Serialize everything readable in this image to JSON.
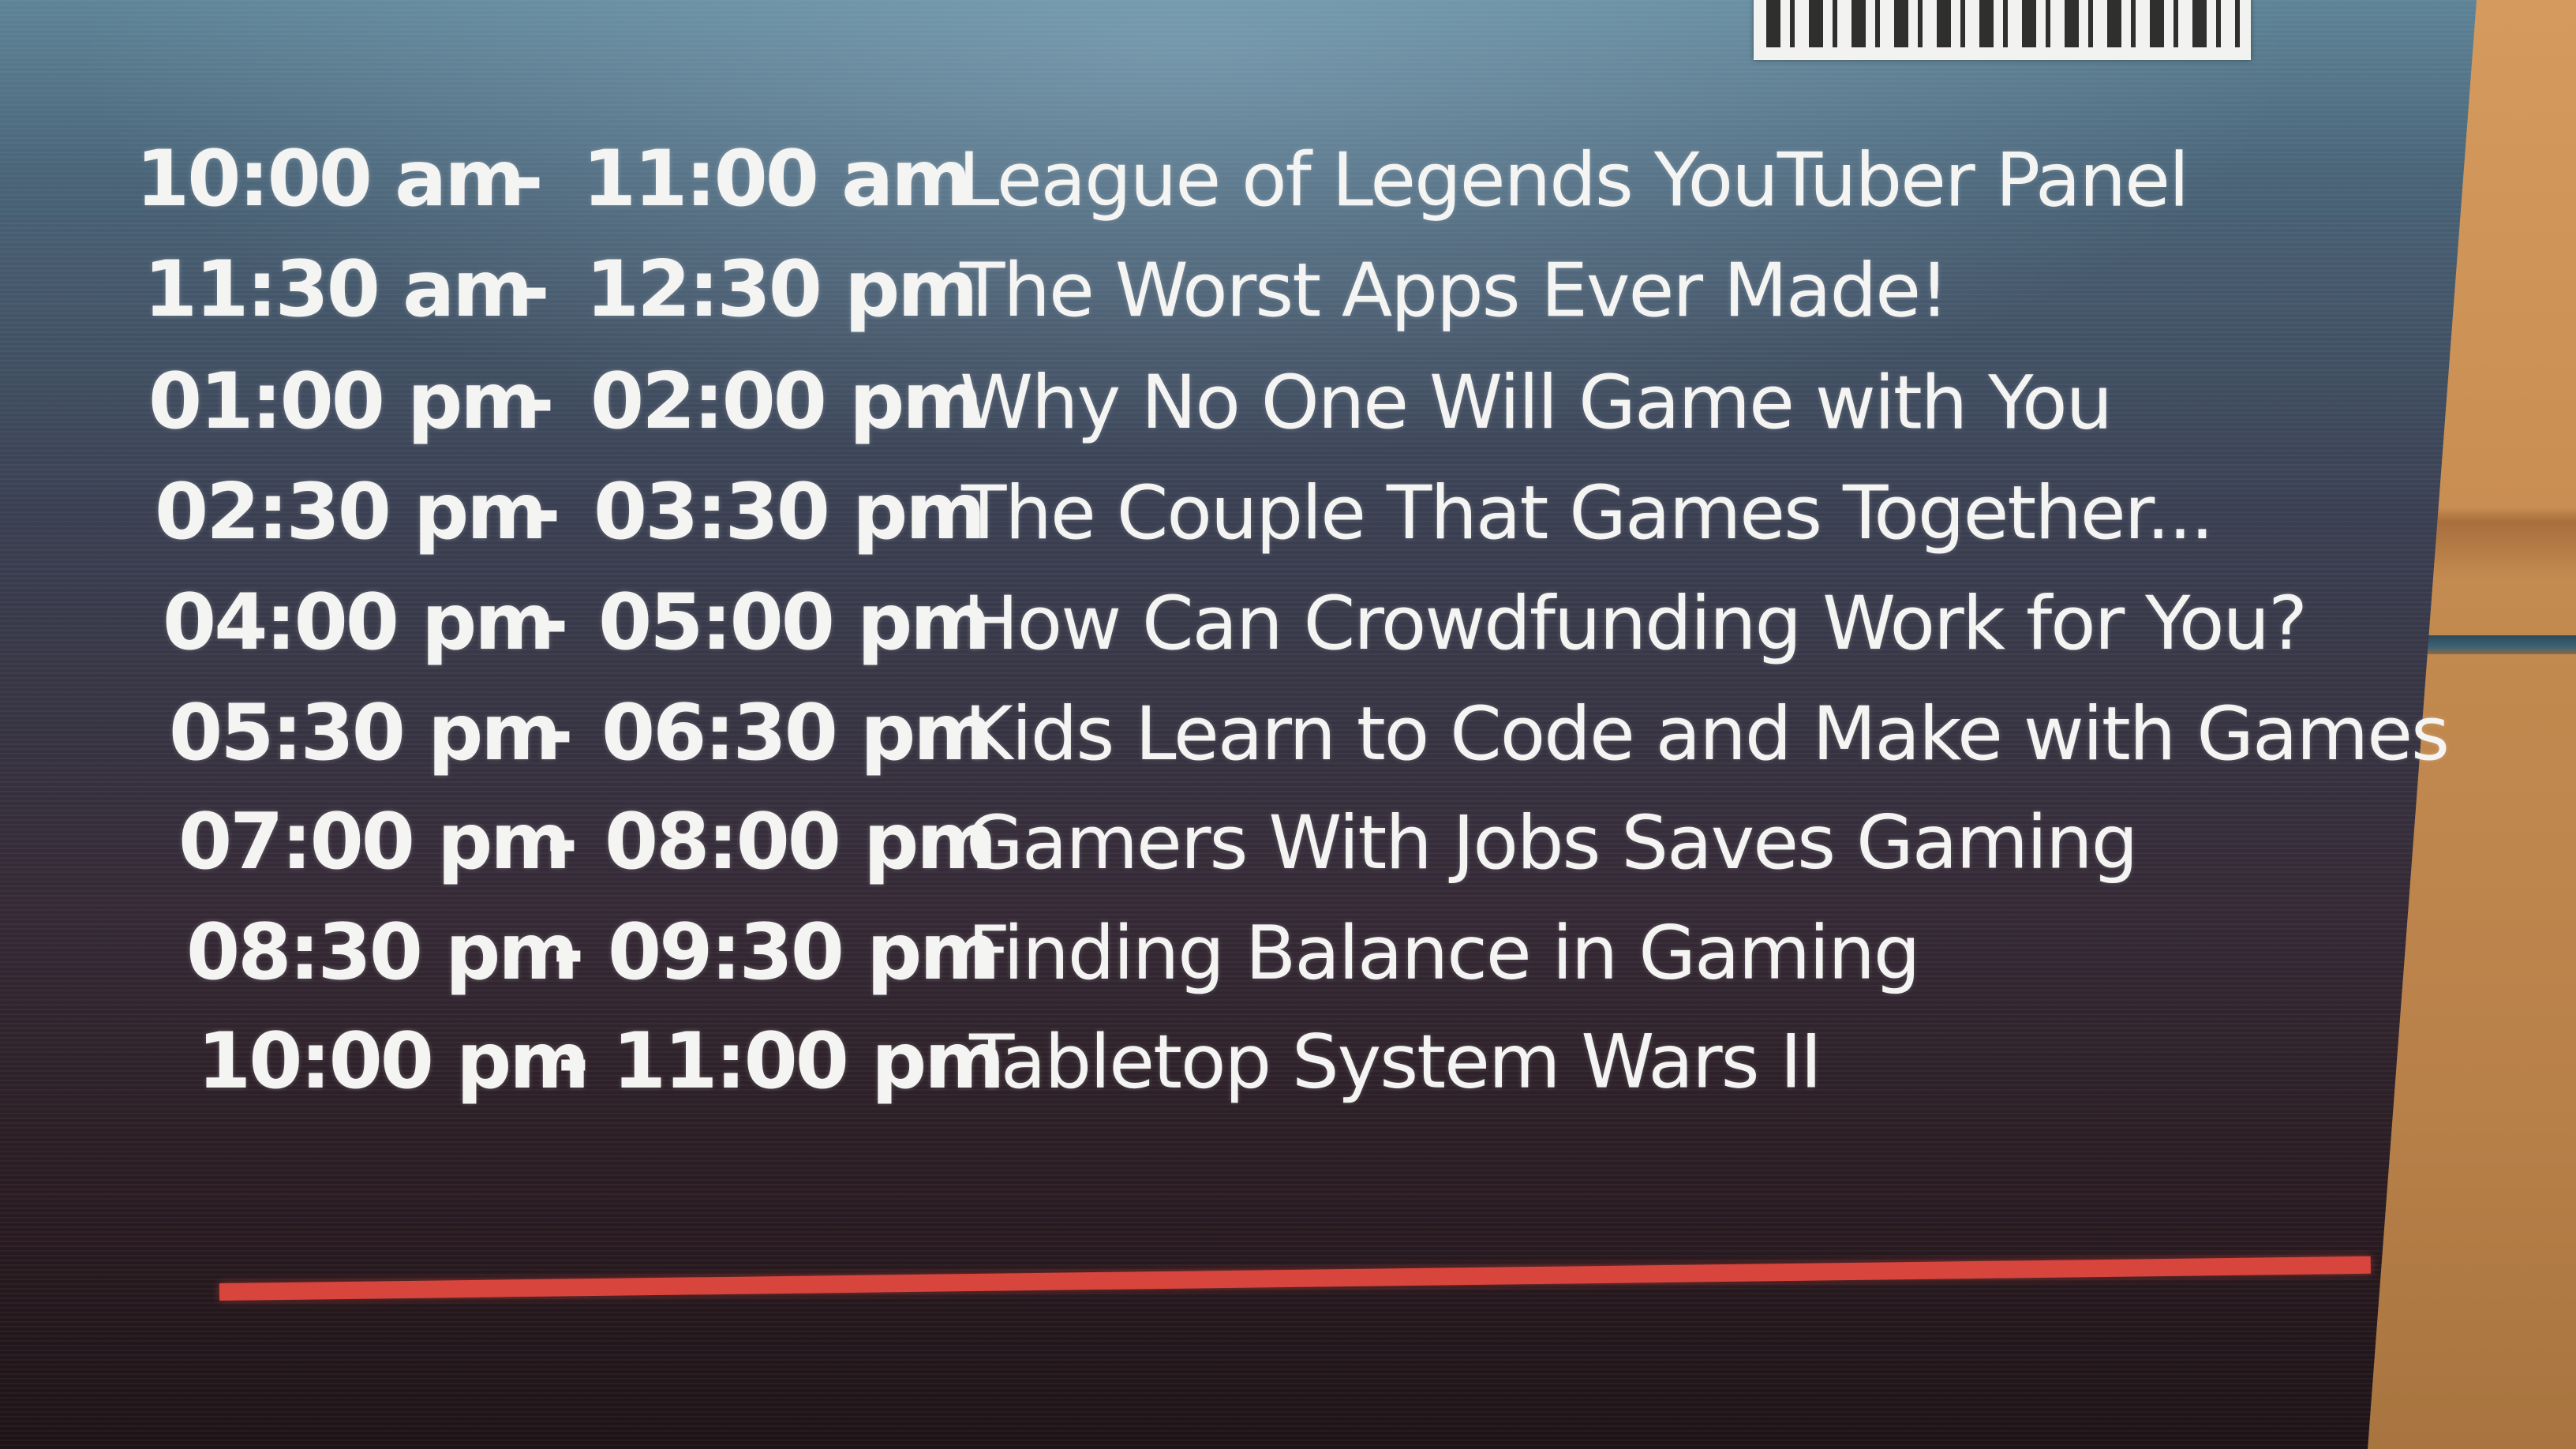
{
  "sign": {
    "schedule": [
      {
        "start": "10:00 am",
        "end": "11:00 am",
        "separator": "-",
        "title": "League of Legends YouTuber Panel"
      },
      {
        "start": "11:30 am",
        "end": "12:30 pm",
        "separator": "-",
        "title": "The Worst Apps Ever Made!"
      },
      {
        "start": "01:00 pm",
        "end": "02:00 pm",
        "separator": "-",
        "title": "Why No One Will Game with You"
      },
      {
        "start": "02:30 pm",
        "end": "03:30 pm",
        "separator": "-",
        "title": "The Couple That Games Together..."
      },
      {
        "start": "04:00 pm",
        "end": "05:00 pm",
        "separator": "-",
        "title": "How Can Crowdfunding Work for You?"
      },
      {
        "start": "05:30 pm",
        "end": "06:30 pm",
        "separator": "-",
        "title": "Kids Learn to Code and Make with Games"
      },
      {
        "start": "07:00 pm",
        "end": "08:00 pm",
        "separator": "-",
        "title": "Gamers With Jobs Saves Gaming"
      },
      {
        "start": "08:30 pm",
        "end": "09:30 pm",
        "separator": "-",
        "title": "Finding Balance in Gaming"
      },
      {
        "start": "10:00 pm",
        "end": "11:00 pm",
        "separator": "-",
        "title": "Tabletop System Wars II"
      }
    ],
    "colors": {
      "text": "#f4f4f2",
      "accent_rule": "#d8453c",
      "board_top": "#5e8497",
      "board_bottom": "#1e1418",
      "wall": "#c48a4e"
    }
  }
}
